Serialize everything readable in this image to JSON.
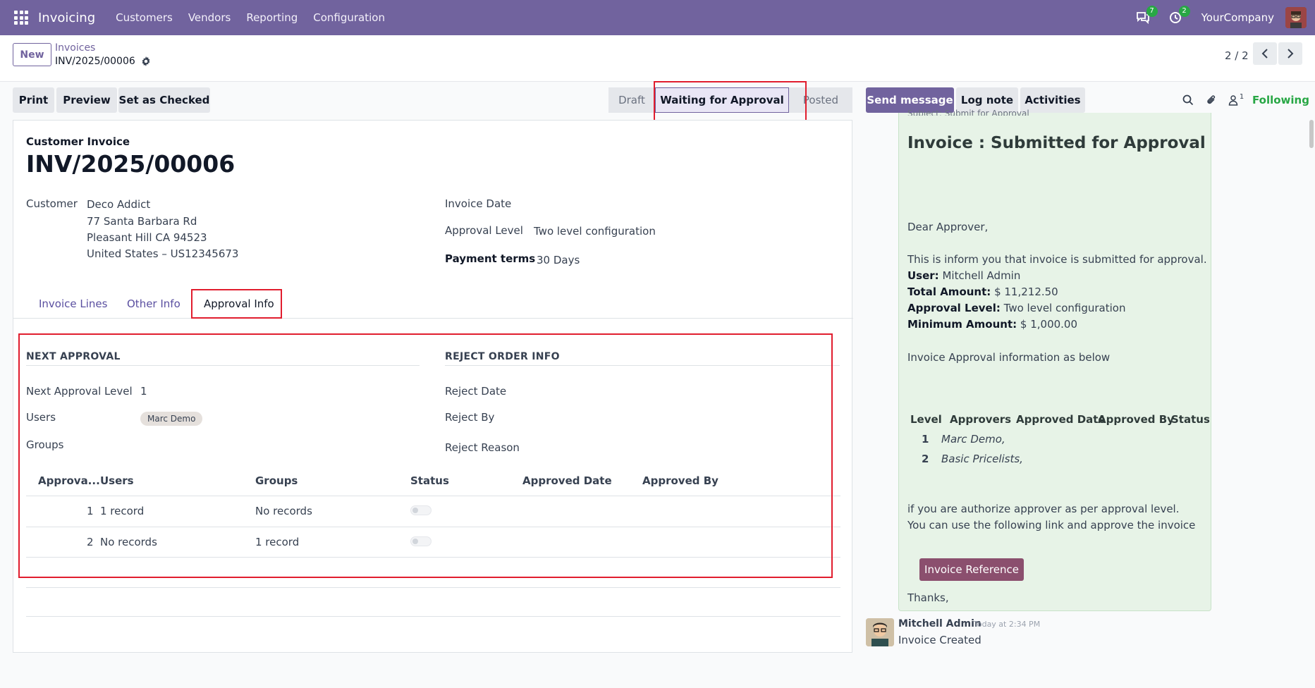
{
  "navbar": {
    "brand": "Invoicing",
    "menu": [
      "Customers",
      "Vendors",
      "Reporting",
      "Configuration"
    ],
    "messages_count": "7",
    "activities_count": "2",
    "company": "YourCompany"
  },
  "control": {
    "new_label": "New",
    "breadcrumb_parent": "Invoices",
    "breadcrumb_current": "INV/2025/00006",
    "pager": "2 / 2"
  },
  "actions": {
    "print": "Print",
    "preview": "Preview",
    "set_checked": "Set as Checked"
  },
  "status": {
    "stages": [
      "Draft",
      "Waiting for Approval",
      "Posted"
    ],
    "current": "Waiting for Approval"
  },
  "chatter_buttons": {
    "send_message": "Send message",
    "log_note": "Log note",
    "activities": "Activities",
    "followers_count": "1",
    "following": "Following"
  },
  "form": {
    "subtype": "Customer Invoice",
    "title": "INV/2025/00006",
    "customer_label": "Customer",
    "customer_name": "Deco Addict",
    "address_line1": "77 Santa Barbara Rd",
    "address_line2": "Pleasant Hill CA 94523",
    "address_line3": "United States – US12345673",
    "invoice_date_label": "Invoice Date",
    "approval_level_label": "Approval Level",
    "approval_level_value": "Two level configuration",
    "payment_terms_label": "Payment terms",
    "payment_terms_value": "30 Days"
  },
  "tabs": [
    "Invoice Lines",
    "Other Info",
    "Approval Info"
  ],
  "approval": {
    "next_title": "NEXT APPROVAL",
    "reject_title": "REJECT ORDER INFO",
    "next_level_label": "Next Approval Level",
    "next_level_value": "1",
    "users_label": "Users",
    "users_tag": "Marc Demo",
    "groups_label": "Groups",
    "reject_date_label": "Reject Date",
    "reject_by_label": "Reject By",
    "reject_reason_label": "Reject Reason"
  },
  "approval_table": {
    "headers": [
      "Approva...",
      "Users",
      "Groups",
      "Status",
      "Approved Date",
      "Approved By"
    ],
    "rows": [
      {
        "level": "1",
        "users": "1 record",
        "groups": "No records"
      },
      {
        "level": "2",
        "users": "No records",
        "groups": "1 record"
      }
    ]
  },
  "mail": {
    "cut_text": "Subject: Submit for Approval",
    "heading": "Invoice : Submitted for Approval",
    "greeting": "Dear Approver,",
    "intro": "This is inform you that invoice is submitted for approval.",
    "user_label": "User:",
    "user_value": "Mitchell Admin",
    "total_label": "Total Amount:",
    "total_value": "$ 11,212.50",
    "level_label": "Approval Level:",
    "level_value": "Two level configuration",
    "minimum_label": "Minimum Amount:",
    "minimum_value": "$ 1,000.00",
    "info_line": "Invoice Approval information as below",
    "table_headers": [
      "Level",
      "Approvers",
      "Approved Date",
      "Approved By",
      "Status"
    ],
    "table_rows": [
      {
        "level": "1",
        "approvers": "Marc Demo,"
      },
      {
        "level": "2",
        "approvers": "Basic Pricelists,"
      }
    ],
    "auth_line1": "if you are authorize approver as per approval level.",
    "auth_line2": "You can use the following link and approve the invoice",
    "button": "Invoice Reference",
    "thanks": "Thanks,"
  },
  "message": {
    "author": "Mitchell Admin",
    "time": "Today at 2:34 PM",
    "body": "Invoice Created"
  }
}
